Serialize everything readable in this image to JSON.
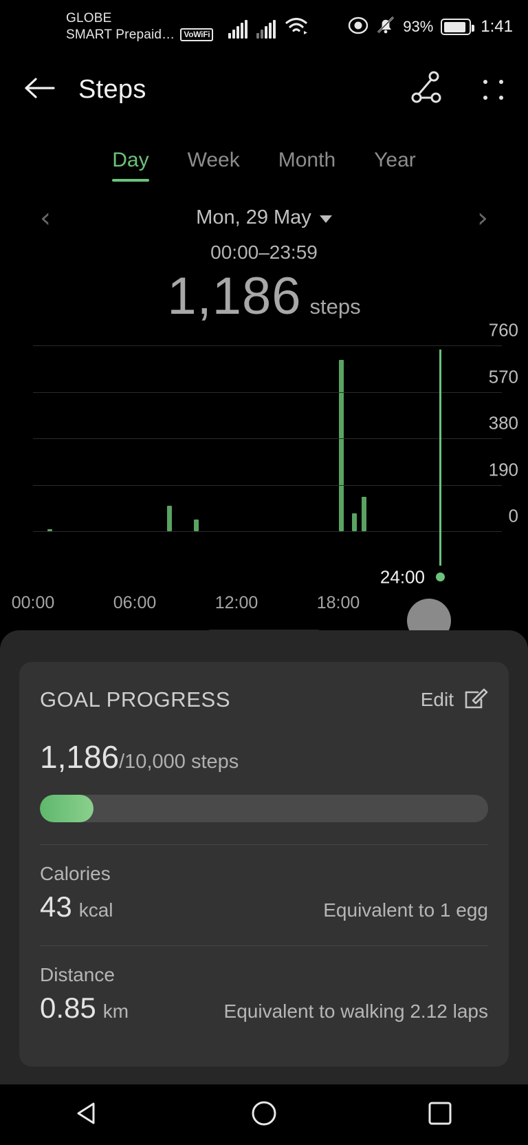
{
  "statusbar": {
    "carrier_primary": "GLOBE",
    "carrier_secondary": "SMART Prepaid…",
    "vowifi_badge": "VoWiFi",
    "battery_percent": "93%",
    "time": "1:41",
    "icons": [
      "signal-icon",
      "signal-icon",
      "wifi-icon",
      "eye-icon",
      "bell-muted-icon",
      "battery-icon"
    ]
  },
  "appbar": {
    "back_icon": "back-arrow-icon",
    "title": "Steps",
    "share_icon": "share-icon",
    "menu_icon": "more-options-icon"
  },
  "tabs": [
    {
      "label": "Day",
      "active": true
    },
    {
      "label": "Week",
      "active": false
    },
    {
      "label": "Month",
      "active": false
    },
    {
      "label": "Year",
      "active": false
    }
  ],
  "date_nav": {
    "prev_icon": "chevron-left-icon",
    "next_icon": "chevron-right-icon",
    "date": "Mon, 29 May",
    "dropdown_icon": "caret-down-icon",
    "time_range": "00:00–23:59"
  },
  "summary": {
    "value": "1,186",
    "unit": "steps"
  },
  "chart_data": {
    "type": "bar",
    "title": "",
    "xlabel": "",
    "ylabel": "",
    "ylim": [
      0,
      760
    ],
    "yticks": [
      "0",
      "190",
      "380",
      "570",
      "760"
    ],
    "xticks": [
      "00:00",
      "06:00",
      "12:00",
      "18:00"
    ],
    "xtick_positions": [
      0,
      25,
      50,
      75
    ],
    "grid": true,
    "legend": "none",
    "x_unit": "hour of day",
    "total_steps": 1186,
    "cursor": {
      "label": "24:00",
      "position_percent": 100,
      "color": "#6cc27a"
    },
    "bars": [
      {
        "x_percent": 3.5,
        "value": 8
      },
      {
        "x_percent": 33.0,
        "value": 105
      },
      {
        "x_percent": 39.5,
        "value": 48
      },
      {
        "x_percent": 75.2,
        "value": 700
      },
      {
        "x_percent": 78.4,
        "value": 72
      },
      {
        "x_percent": 80.8,
        "value": 140
      }
    ]
  },
  "goal_card": {
    "title": "GOAL PROGRESS",
    "edit_label": "Edit",
    "edit_icon": "edit-pencil-icon",
    "current": "1,186",
    "target": "/10,000 steps",
    "progress_percent": 11.9,
    "progress_color": "#6cc27a",
    "metrics": [
      {
        "label": "Calories",
        "value": "43",
        "unit": "kcal",
        "equivalent": "Equivalent to 1 egg"
      },
      {
        "label": "Distance",
        "value": "0.85",
        "unit": "km",
        "equivalent": "Equivalent to walking 2.12 laps"
      }
    ]
  },
  "navbar": {
    "back_icon": "nav-back-triangle-icon",
    "home_icon": "nav-home-circle-icon",
    "recents_icon": "nav-recents-square-icon"
  }
}
